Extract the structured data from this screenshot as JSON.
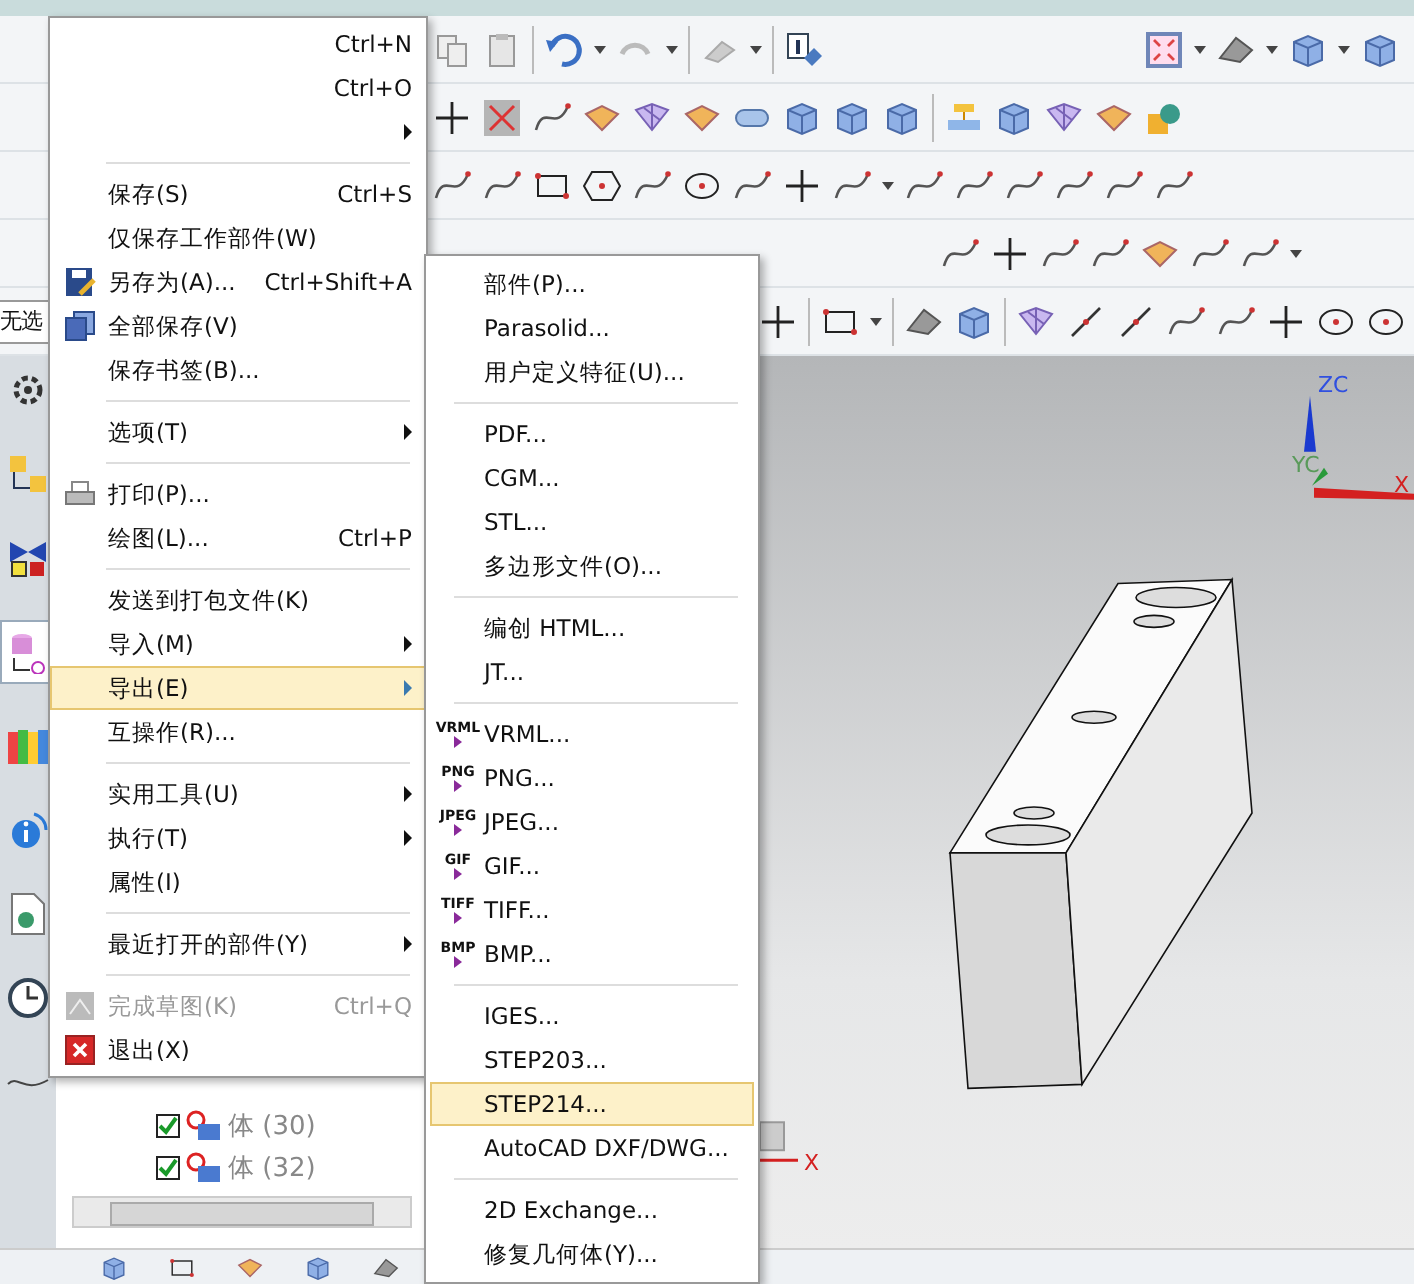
{
  "selection_filter": {
    "value": "无选"
  },
  "file_menu": {
    "items": [
      {
        "kind": "item",
        "shortcut": "Ctrl+N",
        "submenu": false,
        "disabled": false,
        "selected": false
      },
      {
        "kind": "item",
        "shortcut": "Ctrl+O",
        "submenu": false,
        "disabled": false,
        "selected": false
      },
      {
        "kind": "item",
        "submenu": true,
        "disabled": false,
        "selected": false
      },
      {
        "kind": "separator"
      },
      {
        "kind": "item",
        "label": "保存(S)",
        "shortcut": "Ctrl+S",
        "submenu": false,
        "disabled": false,
        "selected": false
      },
      {
        "kind": "item",
        "label": "仅保存工作部件(W)",
        "submenu": false,
        "disabled": false,
        "selected": false
      },
      {
        "kind": "item",
        "label": "另存为(A)...",
        "shortcut": "Ctrl+Shift+A",
        "submenu": false,
        "disabled": false,
        "selected": false
      },
      {
        "kind": "item",
        "label": "全部保存(V)",
        "submenu": false,
        "disabled": false,
        "selected": false
      },
      {
        "kind": "item",
        "label": "保存书签(B)...",
        "submenu": false,
        "disabled": false,
        "selected": false
      },
      {
        "kind": "separator"
      },
      {
        "kind": "item",
        "label": "选项(T)",
        "submenu": true,
        "disabled": false,
        "selected": false
      },
      {
        "kind": "separator"
      },
      {
        "kind": "item",
        "label": "打印(P)...",
        "submenu": false,
        "disabled": false,
        "selected": false
      },
      {
        "kind": "item",
        "label": "绘图(L)...",
        "shortcut": "Ctrl+P",
        "submenu": false,
        "disabled": false,
        "selected": false
      },
      {
        "kind": "separator"
      },
      {
        "kind": "item",
        "label": "发送到打包文件(K)",
        "submenu": false,
        "disabled": false,
        "selected": false
      },
      {
        "kind": "item",
        "label": "导入(M)",
        "submenu": true,
        "disabled": false,
        "selected": false
      },
      {
        "kind": "item",
        "label": "导出(E)",
        "submenu": true,
        "disabled": false,
        "selected": true
      },
      {
        "kind": "item",
        "label": "互操作(R)...",
        "submenu": false,
        "disabled": false,
        "selected": false
      },
      {
        "kind": "separator"
      },
      {
        "kind": "item",
        "label": "实用工具(U)",
        "submenu": true,
        "disabled": false,
        "selected": false
      },
      {
        "kind": "item",
        "label": "执行(T)",
        "submenu": true,
        "disabled": false,
        "selected": false
      },
      {
        "kind": "item",
        "label": "属性(I)",
        "submenu": false,
        "disabled": false,
        "selected": false
      },
      {
        "kind": "separator"
      },
      {
        "kind": "item",
        "label": "最近打开的部件(Y)",
        "submenu": true,
        "disabled": false,
        "selected": false
      },
      {
        "kind": "separator"
      },
      {
        "kind": "item",
        "label": "完成草图(K)",
        "shortcut": "Ctrl+Q",
        "submenu": false,
        "disabled": true,
        "selected": false
      },
      {
        "kind": "item",
        "label": "退出(X)",
        "submenu": false,
        "disabled": false,
        "selected": false
      }
    ]
  },
  "export_menu": {
    "items": [
      {
        "kind": "item",
        "label": "部件(P)...",
        "selected": false
      },
      {
        "kind": "item",
        "label": "Parasolid...",
        "selected": false
      },
      {
        "kind": "item",
        "label": "用户定义特征(U)...",
        "selected": false
      },
      {
        "kind": "separator"
      },
      {
        "kind": "item",
        "label": "PDF...",
        "selected": false
      },
      {
        "kind": "item",
        "label": "CGM...",
        "selected": false
      },
      {
        "kind": "item",
        "label": "STL...",
        "selected": false
      },
      {
        "kind": "item",
        "label": "多边形文件(O)...",
        "selected": false
      },
      {
        "kind": "separator"
      },
      {
        "kind": "item",
        "label": "编创 HTML...",
        "selected": false
      },
      {
        "kind": "item",
        "label": "JT...",
        "selected": false
      },
      {
        "kind": "separator"
      },
      {
        "kind": "item",
        "badge": "VRML",
        "label": "VRML...",
        "selected": false
      },
      {
        "kind": "item",
        "badge": "PNG",
        "label": "PNG...",
        "selected": false
      },
      {
        "kind": "item",
        "badge": "JPEG",
        "label": "JPEG...",
        "selected": false
      },
      {
        "kind": "item",
        "badge": "GIF",
        "label": "GIF...",
        "selected": false
      },
      {
        "kind": "item",
        "badge": "TIFF",
        "label": "TIFF...",
        "selected": false
      },
      {
        "kind": "item",
        "badge": "BMP",
        "label": "BMP...",
        "selected": false
      },
      {
        "kind": "separator"
      },
      {
        "kind": "item",
        "label": "IGES...",
        "selected": false
      },
      {
        "kind": "item",
        "label": "STEP203...",
        "selected": false
      },
      {
        "kind": "item",
        "label": "STEP214...",
        "selected": true
      },
      {
        "kind": "item",
        "label": "AutoCAD DXF/DWG...",
        "selected": false
      },
      {
        "kind": "separator"
      },
      {
        "kind": "item",
        "label": "2D Exchange...",
        "selected": false
      },
      {
        "kind": "item",
        "label": "修复几何体(Y)...",
        "selected": false
      }
    ]
  },
  "part_navigator": {
    "rows": [
      {
        "label": "体 (30)",
        "checked": true
      },
      {
        "label": "体 (32)",
        "checked": true
      }
    ]
  },
  "viewport": {
    "triad_labels": [
      "ZC",
      "YC",
      "X"
    ],
    "mini_triad_label": "X"
  }
}
